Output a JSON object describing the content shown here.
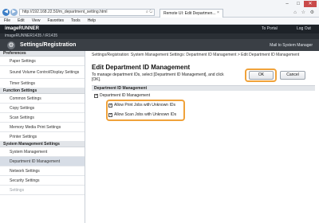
{
  "browser": {
    "url": "http://192.168.22.50/m_department_setting.html",
    "tab_title": "Remote UI: Edit Departmen...",
    "win_minimize": "–",
    "win_restore": "□",
    "win_close": "✕",
    "back": "◀",
    "forward": "▶",
    "addr_icons": "⌕ ↻",
    "tab_close": "×",
    "toolbar_icons": "⌂ ☆ ⚙"
  },
  "menu": [
    "File",
    "Edit",
    "View",
    "Favorites",
    "Tools",
    "Help"
  ],
  "header": {
    "brand": "imageRUNNER",
    "model": "imageRUNNER1435 / iR1435",
    "portal_link": "To Portal",
    "logout_link": "Log Out",
    "title": "Settings/Registration",
    "mail_link": "Mail to System Manager",
    "gear_glyph": "⚙"
  },
  "sidebar": {
    "sections": [
      {
        "heading": "Preferences",
        "items": [
          {
            "label": "Paper Settings",
            "lines": 1
          },
          {
            "label": "Sound Volume Control/Display Settings",
            "lines": 2
          },
          {
            "label": "Timer Settings",
            "lines": 1
          }
        ]
      },
      {
        "heading": "Function Settings",
        "items": [
          {
            "label": "Common Settings",
            "lines": 1
          },
          {
            "label": "Copy Settings",
            "lines": 1
          },
          {
            "label": "Scan Settings",
            "lines": 1
          },
          {
            "label": "Memory Media Print Settings",
            "lines": 1
          },
          {
            "label": "Printer Settings",
            "lines": 1
          }
        ]
      },
      {
        "heading": "System Management Settings",
        "items": [
          {
            "label": "System Management",
            "lines": 1
          },
          {
            "label": "Department ID Management",
            "lines": 1,
            "active": true
          },
          {
            "label": "Network Settings",
            "lines": 1
          },
          {
            "label": "Security Settings",
            "lines": 1
          },
          {
            "label": "Settings",
            "lines": 1,
            "dim": true
          }
        ]
      }
    ]
  },
  "main": {
    "breadcrumb": "Settings/Registration: System Management Settings: Department ID Management > Edit Department ID Management",
    "title": "Edit Department ID Management",
    "instruction": "To manage department IDs, select [Department ID Management], and click [OK].",
    "ok_label": "OK",
    "cancel_label": "Cancel",
    "section_title": "Department ID Management",
    "dept_id_mgmt": {
      "label": "Department ID Management",
      "checked": true
    },
    "allow_print": {
      "label": "Allow Print Jobs with Unknown IDs",
      "checked": true
    },
    "allow_scan": {
      "label": "Allow Scan Jobs with Unknown IDs",
      "checked": true
    },
    "check_glyph": "✓"
  },
  "colors": {
    "highlight": "#f0a23a",
    "header_bg": "#1d2228",
    "title_bar_bg": "#3a3f45",
    "active_item": "#d7dde6"
  }
}
